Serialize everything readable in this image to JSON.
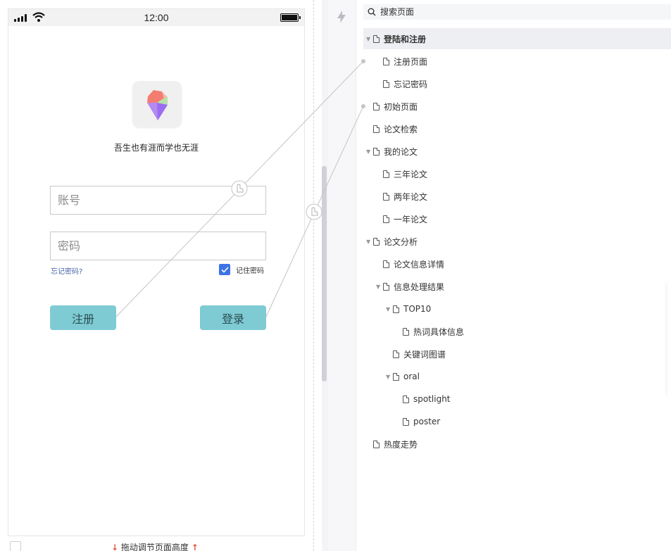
{
  "status_bar": {
    "time": "12:00"
  },
  "app": {
    "slogan": "吾生也有涯而学也无涯",
    "account_placeholder": "账号",
    "password_placeholder": "密码",
    "forgot_link": "忘记密码?",
    "remember_label": "记住密码",
    "register_button": "注册",
    "login_button": "登录"
  },
  "canvas_footer": {
    "hint": "拖动调节页面高度"
  },
  "page_tree": {
    "search_placeholder": "搜索页面",
    "items": [
      {
        "label": "登陆和注册",
        "level": 0,
        "expandable": true,
        "active": true
      },
      {
        "label": "注册页面",
        "level": 1,
        "expandable": false
      },
      {
        "label": "忘记密码",
        "level": 1,
        "expandable": false
      },
      {
        "label": "初始页面",
        "level": 0,
        "expandable": false
      },
      {
        "label": "论文检索",
        "level": 0,
        "expandable": false
      },
      {
        "label": "我的论文",
        "level": 0,
        "expandable": true
      },
      {
        "label": "三年论文",
        "level": 1,
        "expandable": false
      },
      {
        "label": "两年论文",
        "level": 1,
        "expandable": false
      },
      {
        "label": "一年论文",
        "level": 1,
        "expandable": false
      },
      {
        "label": "论文分析",
        "level": 0,
        "expandable": true
      },
      {
        "label": "论文信息详情",
        "level": 1,
        "expandable": false
      },
      {
        "label": "信息处理结果",
        "level": 1,
        "expandable": true
      },
      {
        "label": "TOP10",
        "level": 2,
        "expandable": true
      },
      {
        "label": "热词具体信息",
        "level": 3,
        "expandable": false
      },
      {
        "label": "关键词图谱",
        "level": 2,
        "expandable": false
      },
      {
        "label": "oral",
        "level": 2,
        "expandable": true
      },
      {
        "label": "spotlight",
        "level": 3,
        "expandable": false
      },
      {
        "label": "poster",
        "level": 3,
        "expandable": false
      },
      {
        "label": "热度走势",
        "level": 0,
        "expandable": false
      }
    ]
  },
  "colors": {
    "button_teal": "#7ecbd3",
    "checkbox_blue": "#3c73e6",
    "link_blue": "#4a66a8",
    "arrow_red": "#e0533b"
  },
  "icons": [
    "signal-icon",
    "wifi-icon",
    "battery-icon",
    "app-logo-icon",
    "check-icon",
    "arrow-down-icon",
    "arrow-up-icon",
    "lightning-icon",
    "search-icon",
    "page-icon",
    "caret-down-icon",
    "hotspot-hand-icon"
  ]
}
